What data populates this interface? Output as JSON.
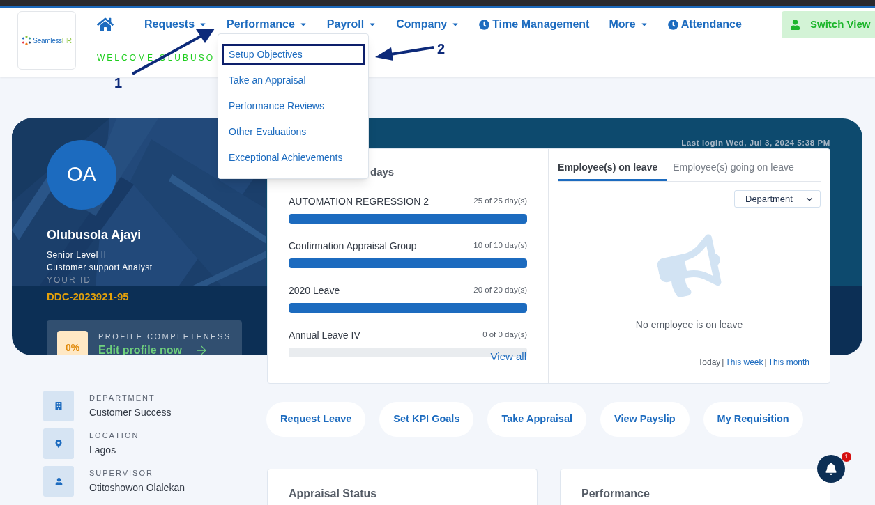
{
  "header": {
    "logo": {
      "name": "Seamless",
      "accent": "HR"
    },
    "nav": [
      {
        "kind": "home"
      },
      {
        "kind": "menu",
        "label": "Requests"
      },
      {
        "kind": "menu",
        "label": "Performance"
      },
      {
        "kind": "menu",
        "label": "Payroll"
      },
      {
        "kind": "menu",
        "label": "Company"
      },
      {
        "kind": "clock",
        "label": "Time Management"
      },
      {
        "kind": "menu",
        "label": "More"
      },
      {
        "kind": "clock",
        "label": "Attendance"
      }
    ],
    "welcome": "WELCOME OLUBUSO",
    "switch_view": "Switch View"
  },
  "performance_menu": [
    {
      "label": "Setup Objectives",
      "highlighted": true
    },
    {
      "label": "Take an Appraisal",
      "highlighted": false
    },
    {
      "label": "Performance Reviews",
      "highlighted": false
    },
    {
      "label": "Other Evaluations",
      "highlighted": false
    },
    {
      "label": "Exceptional Achievements",
      "highlighted": false
    }
  ],
  "annotations": [
    {
      "label": "1"
    },
    {
      "label": "2"
    }
  ],
  "profile": {
    "initials": "OA",
    "name": "Olubusola Ajayi",
    "level": "Senior Level II",
    "role": "Customer support Analyst",
    "id_label": "YOUR ID",
    "id": "DDC-2023921-95",
    "completeness_label": "PROFILE COMPLETENESS",
    "completeness": "0%",
    "edit_link": "Edit profile now"
  },
  "last_login": "Last login Wed, Jul 3, 2024 5:38 PM",
  "leave": {
    "heading": "days",
    "types": [
      {
        "name": "AUTOMATION REGRESSION 2",
        "reading": "25 of 25 day(s)",
        "level": 1
      },
      {
        "name": "Confirmation Appraisal Group",
        "reading": "10 of 10 day(s)",
        "level": 1
      },
      {
        "name": "2020 Leave",
        "reading": "20 of 20 day(s)",
        "level": 1
      },
      {
        "name": "Annual Leave IV",
        "reading": "0 of 0 day(s)",
        "level": 0
      }
    ],
    "view_all": "View all"
  },
  "on_leave": {
    "tabs": [
      {
        "label": "Employee(s) on leave",
        "selected": true
      },
      {
        "label": "Employee(s) going on leave",
        "selected": false
      }
    ],
    "filter": "Department",
    "empty": "No employee is on leave",
    "periods": [
      {
        "label": "Today",
        "selected": true
      },
      {
        "label": "This week",
        "selected": false
      },
      {
        "label": "This month",
        "selected": false
      }
    ],
    "separator": "|"
  },
  "details": [
    {
      "kind": "department",
      "label": "DEPARTMENT",
      "value": "Customer Success"
    },
    {
      "kind": "location",
      "label": "LOCATION",
      "value": "Lagos"
    },
    {
      "kind": "supervisor",
      "label": "SUPERVISOR",
      "value": "Otitoshowon Olalekan"
    }
  ],
  "quick_actions": [
    "Request Leave",
    "Set KPI Goals",
    "Take Appraisal",
    "View Payslip",
    "My Requisition"
  ],
  "cards": [
    "Appraisal Status",
    "Performance"
  ],
  "notifications": {
    "count": "1"
  }
}
